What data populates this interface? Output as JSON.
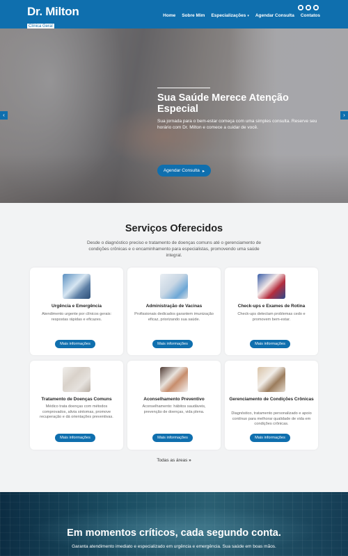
{
  "header": {
    "logo_name": "Dr. Milton",
    "logo_sub": "Clínica Geral",
    "nav": [
      {
        "label": "Home"
      },
      {
        "label": "Sobre Mim"
      },
      {
        "label": "Especializações"
      },
      {
        "label": "Agendar Consulta"
      },
      {
        "label": "Contatos"
      }
    ],
    "social_icons": [
      "instagram-icon",
      "whatsapp-icon",
      "email-icon"
    ]
  },
  "hero": {
    "title": "Sua Saúde Merece Atenção Especial",
    "text": "Sua jornada para o bem-estar começa com uma simples consulta. Reserve seu horário com Dr. Milton e comece a cuidar de você.",
    "button": "Agendar Consulta"
  },
  "services": {
    "title": "Serviços Oferecidos",
    "description": "Desde o diagnóstico preciso e tratamento de doenças comuns até o gerenciamento de condições crônicas e o encaminhamento para especialistas, promovendo uma saúde integral.",
    "cards": [
      {
        "title": "Urgência e Emergência",
        "text": "Atendimento urgente por clínicos gerais: respostas rápidas e eficazes.",
        "button": "Mais informações"
      },
      {
        "title": "Administração de Vacinas",
        "text": "Profissionais dedicados garantem imunização eficaz, priorizando sua saúde.",
        "button": "Mais informações"
      },
      {
        "title": "Check-ups e Exames de Rotina",
        "text": "Check-ups detectam problemas cedo e promovem bem-estar.",
        "button": "Mais informações"
      },
      {
        "title": "Tratamento de Doenças Comuns",
        "text": "Médico trata doenças com métodos comprovados, alivia sintomas, promove recuperação e dá orientações preventivas.",
        "button": "Mais informações"
      },
      {
        "title": "Aconselhamento Preventivo",
        "text": "Aconselhamento: hábitos saudáveis, prevenção de doenças, vida plena.",
        "button": "Mais informações"
      },
      {
        "title": "Gerenciamento de Condições Crônicas",
        "text": "Diagnóstico, tratamento personalizado e apoio contínuo para melhorar qualidade de vida em condições crônicas.",
        "button": "Mais informações"
      }
    ],
    "all_areas": "Todas as áreas"
  },
  "banner": {
    "title": "Em momentos críticos, cada segundo conta.",
    "text": "Garanta atendimento imediato e especializado em urgência e emergência. Sua saúde em boas mãos."
  },
  "colors": {
    "primary": "#0f6fae",
    "background": "#f2f3f4"
  }
}
